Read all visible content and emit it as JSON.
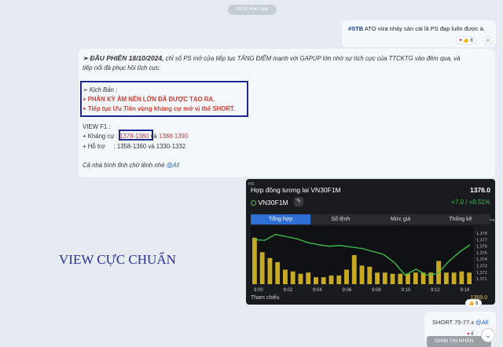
{
  "time_pill": "09:12 Hôm qua",
  "msg1": {
    "tag": "#STB",
    "text": " ATO vừa nháy sàn cái là PS đạp luôn được a.",
    "reactions": {
      "heart": "♥",
      "thumb": "👍",
      "count": "8"
    }
  },
  "msg2": {
    "headline_prefix": "➢ ĐẦU PHIÊN 18/10/2024,",
    "headline_rest": " chỉ số PS mở cửa tiếp tục TĂNG ĐIỂM mạnh với GAPUP lớn nhờ sự tích cực của TTCKTG vào đêm qua, và",
    "headline_line2": "tiếp nối đà phục hồi tích cực.",
    "scenario_title": "➢ Kịch Bản :",
    "scenario_1": "+ PHÂN KỲ ÂM NẾN LỚN ĐÃ ĐƯỢC TẠO RA.",
    "scenario_2": "+ Tiếp tục Ưu Tiên vùng kháng cự mở vị thế SHORT.",
    "view_title": "VIEW F1 :",
    "res_label": "+ Kháng cự :",
    "res_1": "1378-1380",
    "res_and": " và ",
    "res_2": "1388-1390",
    "sup_label": "+ Hỗ trợ",
    "sup_vals": ":   1358-1360 và 1330-1332",
    "footer": "Cả nhà bình tĩnh chờ lệnh nhé ",
    "footer_mention": "@All"
  },
  "phone": {
    "hd": "HD",
    "title": "Hợp đồng tương lai VN30F1M",
    "price": "1376.0",
    "symbol": "VN30F1M",
    "edit_icon": "✎",
    "change": "+7.0 / +0.51%",
    "tabs": [
      "Tổng hợp",
      "Sổ lệnh",
      "Mức giá",
      "Thống kê"
    ],
    "footer_left": "Tham chiếu",
    "footer_right": "1369.0"
  },
  "chart_data": {
    "type": "bar",
    "x_labels": [
      "9:00",
      "9:02",
      "9:04",
      "9:06",
      "9:08",
      "9:10",
      "9:12",
      "9:14"
    ],
    "y_labels": [
      "1,378",
      "1,377",
      "1,376",
      "1,375",
      "1,374",
      "1,373",
      "1,372",
      "1,371"
    ],
    "volume": [
      0.8,
      0.55,
      0.45,
      0.38,
      0.25,
      0.22,
      0.18,
      0.2,
      0.12,
      0.12,
      0.15,
      0.15,
      0.25,
      0.5,
      0.32,
      0.3,
      0.2,
      0.2,
      0.18,
      0.18,
      0.18,
      0.2,
      0.2,
      0.2,
      0.4,
      0.2,
      0.2,
      0.22,
      0.2
    ],
    "price": [
      1376.6,
      1376.5,
      1377.3,
      1377.0,
      1376.7,
      1376.2,
      1375.9,
      1375.7,
      1375.8,
      1375.6,
      1375.4,
      1375.0,
      1374.6,
      1373.5,
      1371.8,
      1372.6,
      1371.8,
      1372.0,
      1373.6,
      1374.9,
      1375.9
    ],
    "colors": {
      "bar": "#c7a923",
      "line": "#3ec54a"
    },
    "ylim": [
      1371,
      1378
    ]
  },
  "view_label": "VIEW CỰC CHUẨN",
  "msg3": {
    "text": "SHORT 75-77.x ",
    "mention": "@All",
    "reactions": {
      "heart": "♥",
      "count": "8"
    }
  },
  "pin_button": "GHIM TIN NHẮN",
  "scroll_icon": "⌄",
  "reply_icon": "↪"
}
